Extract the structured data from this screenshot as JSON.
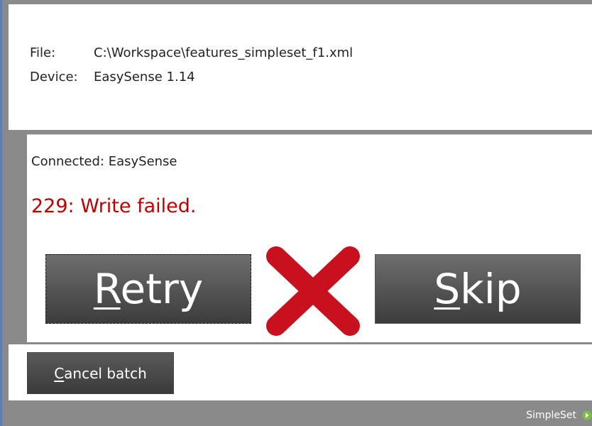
{
  "info": {
    "file_label": "File:",
    "file_value": "C:\\Workspace\\features_simpleset_f1.xml",
    "device_label": "Device:",
    "device_value": "EasySense 1.14"
  },
  "status": {
    "connected_text": "Connected: EasySense",
    "error_text": "229: Write failed.",
    "error_color": "#c00000",
    "status_icon": "error-x-icon"
  },
  "actions": {
    "retry_first": "R",
    "retry_rest": "etry",
    "skip_first": "S",
    "skip_rest": "kip",
    "cancel_first": "C",
    "cancel_rest": "ancel batch"
  },
  "footer": {
    "brand": "SimpleSet",
    "brand_icon": "forward-arrow-icon",
    "brand_icon_color": "#7bc043"
  }
}
